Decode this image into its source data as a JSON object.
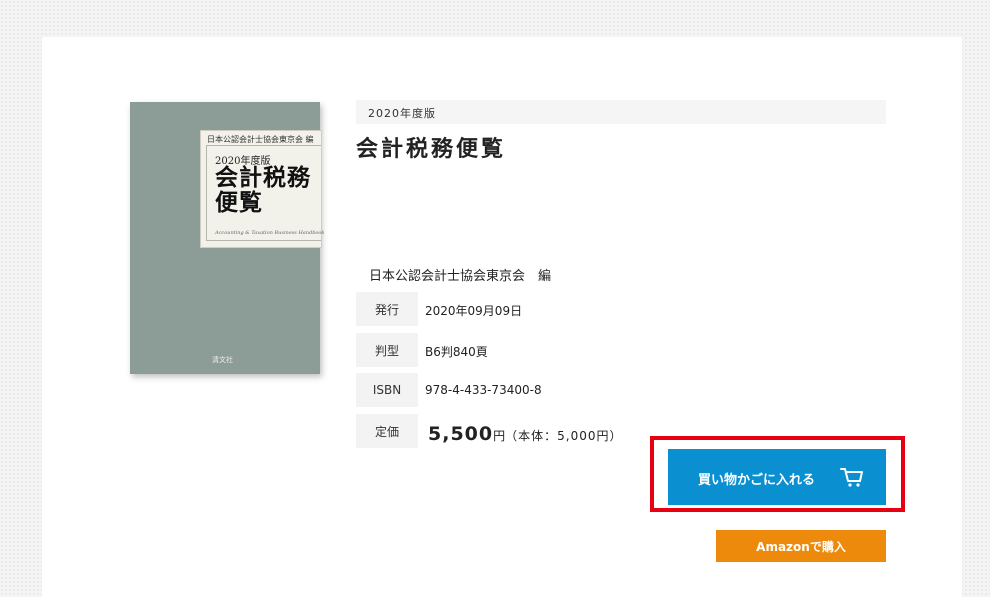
{
  "book": {
    "edition": "2020年度版",
    "title": "会計税務便覧",
    "author": "日本公認会計士協会東京会　編",
    "cover": {
      "editor_line": "日本公認会計士協会東京会 編",
      "edition": "2020年度版",
      "title": "会計税務便覧",
      "subtitle": "Accounting & Taxation Business Handbook",
      "publisher": "清文社",
      "background_color": "#8c9c96"
    }
  },
  "details": [
    {
      "label": "発行",
      "value": "2020年09月09日"
    },
    {
      "label": "判型",
      "value": "B6判840頁"
    },
    {
      "label": "ISBN",
      "value": "978-4-433-73400-8"
    }
  ],
  "price": {
    "label": "定価",
    "amount": "5,500",
    "yen": "円",
    "tax_note": "（本体：5,000円）"
  },
  "actions": {
    "cart_label": "買い物かごに入れる",
    "cart_icon": "cart-icon",
    "cart_color": "#0a8fd1",
    "highlight_color": "#e60012",
    "amazon_label": "Amazonで購入",
    "amazon_color": "#ee8a0b"
  }
}
